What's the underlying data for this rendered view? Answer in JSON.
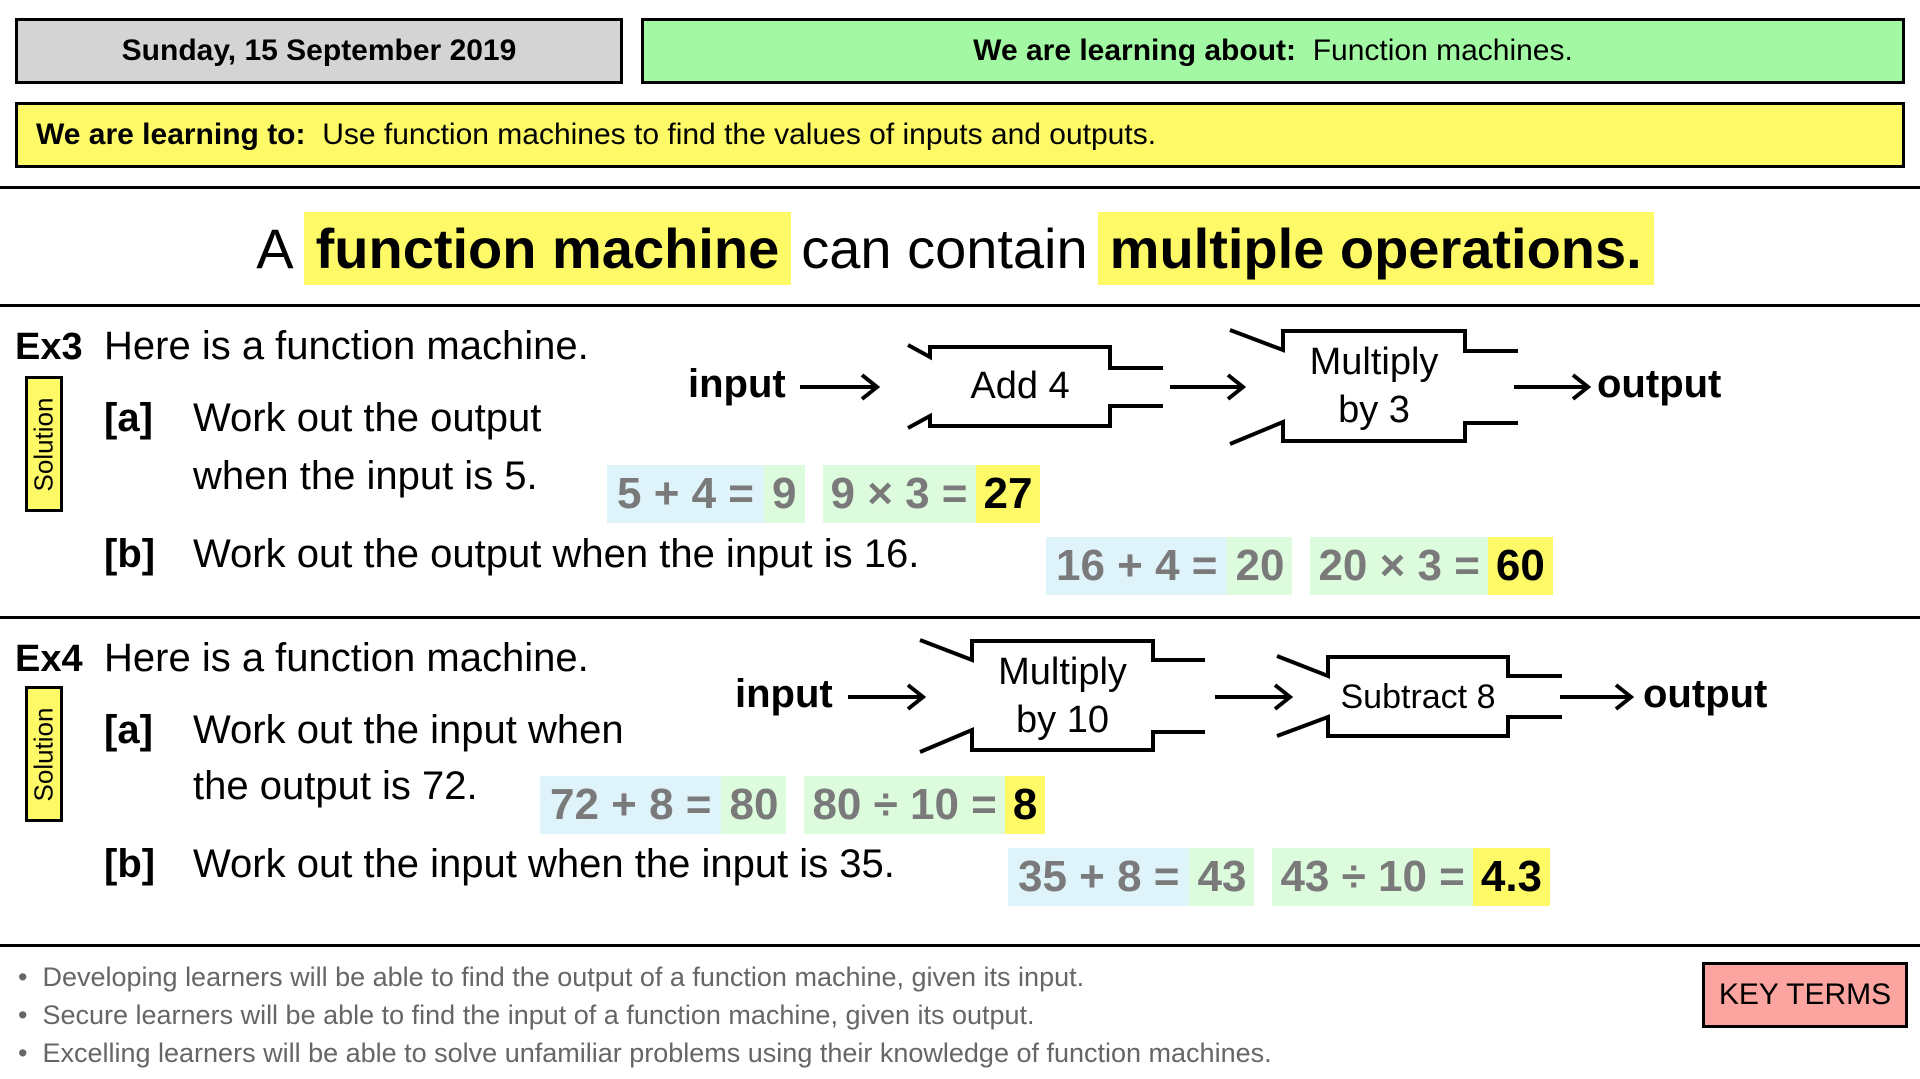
{
  "header": {
    "date": "Sunday, 15 September 2019",
    "learning_about_label": "We are learning about:",
    "learning_about_value": "Function machines.",
    "learning_to_label": "We are learning to:",
    "learning_to_value": "Use function machines to find the values of inputs and outputs."
  },
  "headline": {
    "prefix": "A",
    "term1": "function machine",
    "middle": "can contain",
    "term2": "multiple operations",
    "suffix": "."
  },
  "ex3": {
    "label": "Ex3",
    "intro": "Here is a function machine.",
    "solution_label": "Solution",
    "part_a_label": "[a]",
    "part_a_line1": "Work out the output",
    "part_a_line2": "when the input is 5.",
    "part_b_label": "[b]",
    "part_b_text": "Work out the output when the input is 16.",
    "machine": {
      "input": "input",
      "op1": "Add 4",
      "op2_line1": "Multiply",
      "op2_line2": "by 3",
      "output": "output"
    },
    "answer_a": {
      "step1": "5 + 4 =",
      "mid": "9",
      "step2": "9 × 3 =",
      "result": "27"
    },
    "answer_b": {
      "step1": "16 + 4 =",
      "mid": "20",
      "step2": "20 × 3 =",
      "result": "60"
    }
  },
  "ex4": {
    "label": "Ex4",
    "intro": "Here is a function machine.",
    "solution_label": "Solution",
    "part_a_label": "[a]",
    "part_a_line1": "Work out the input when",
    "part_a_line2": "the output is 72.",
    "part_b_label": "[b]",
    "part_b_text": "Work out the input when the input is 35.",
    "machine": {
      "input": "input",
      "op1_line1": "Multiply",
      "op1_line2": "by 10",
      "op2": "Subtract 8",
      "output": "output"
    },
    "answer_a": {
      "step1": "72 + 8 =",
      "mid": "80",
      "step2": "80 ÷ 10 =",
      "result": "8"
    },
    "answer_b": {
      "step1": "35 + 8 =",
      "mid": "43",
      "step2": "43 ÷ 10 =",
      "result": "4.3"
    }
  },
  "footer": {
    "bullets": [
      "Developing learners will be able to find the output of a function machine, given its input.",
      "Secure learners will be able to find the input of a function machine, given its output.",
      "Excelling learners will be able to solve unfamiliar problems using their knowledge of function machines."
    ],
    "key_terms": "KEY TERMS"
  }
}
